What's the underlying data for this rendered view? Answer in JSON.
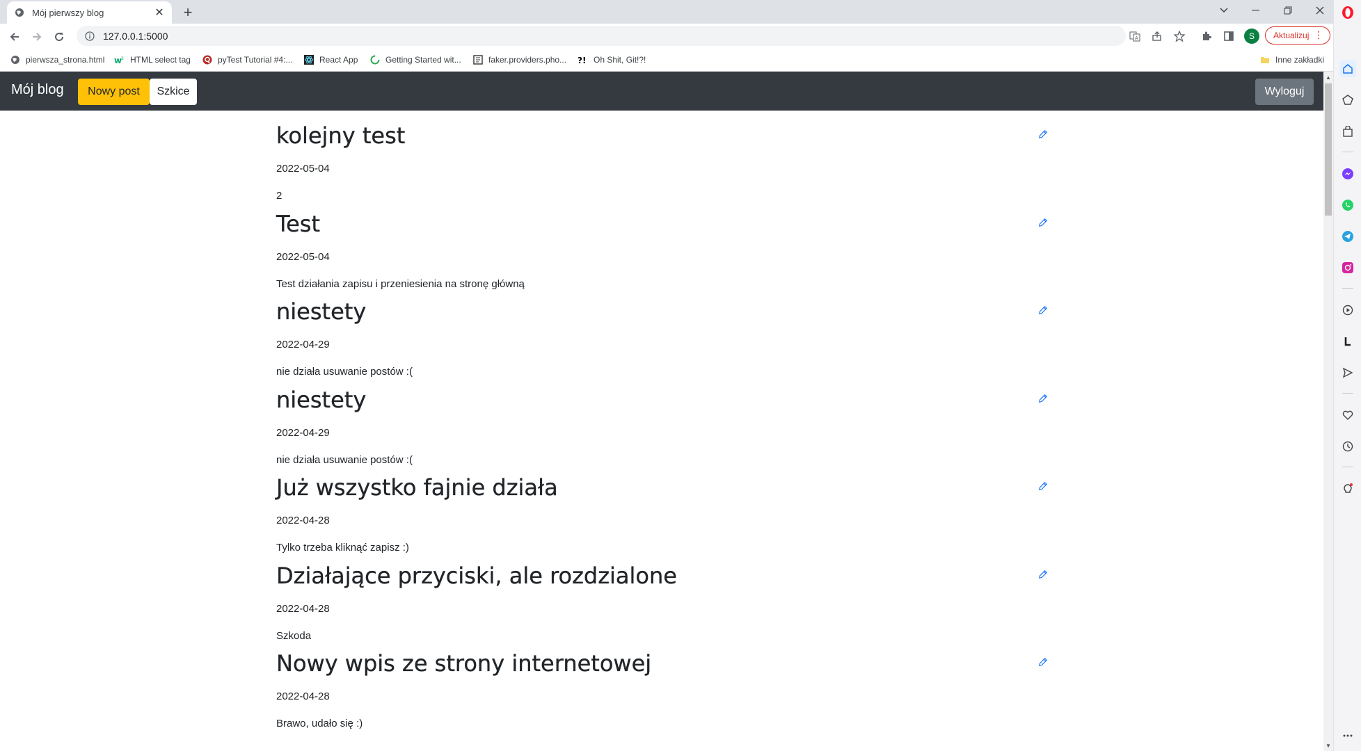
{
  "browser": {
    "tab": {
      "title": "Mój pierwszy blog",
      "favicon": "globe-icon"
    },
    "address": {
      "url": "127.0.0.1:5000"
    },
    "update_label": "Aktualizuj",
    "profile_initial": "S",
    "bookmarks": [
      {
        "label": "pierwsza_strona.html",
        "icon": "globe-icon"
      },
      {
        "label": "HTML select tag",
        "icon": "w3schools-icon"
      },
      {
        "label": "pyTest Tutorial #4:...",
        "icon": "q-icon"
      },
      {
        "label": "React App",
        "icon": "react-icon"
      },
      {
        "label": "Getting Started wit...",
        "icon": "spinner-icon"
      },
      {
        "label": "faker.providers.pho...",
        "icon": "doc-icon"
      },
      {
        "label": "Oh Shit, Git!?!",
        "icon": "exclaim-icon"
      }
    ],
    "other_bookmarks": "Inne zakładki"
  },
  "navbar": {
    "brand": "Mój blog",
    "new_post": "Nowy post",
    "drafts": "Szkice",
    "logout": "Wyloguj"
  },
  "posts": [
    {
      "title": "kolejny test",
      "date": "2022-05-04",
      "body": "2"
    },
    {
      "title": "Test",
      "date": "2022-05-04",
      "body": "Test działania zapisu i przeniesienia na stronę główną"
    },
    {
      "title": "niestety",
      "date": "2022-04-29",
      "body": "nie działa usuwanie postów :("
    },
    {
      "title": "niestety",
      "date": "2022-04-29",
      "body": "nie działa usuwanie postów :("
    },
    {
      "title": "Już wszystko fajnie działa",
      "date": "2022-04-28",
      "body": "Tylko trzeba kliknąć zapisz :)"
    },
    {
      "title": "Działające przyciski, ale rozdzialone",
      "date": "2022-04-28",
      "body": "Szkoda"
    },
    {
      "title": "Nowy wpis ze strony internetowej",
      "date": "2022-04-28",
      "body": "Brawo, udało się :)"
    }
  ],
  "colors": {
    "accent": "#ffc107",
    "navbar": "#343a40",
    "link": "#0d6efd"
  }
}
